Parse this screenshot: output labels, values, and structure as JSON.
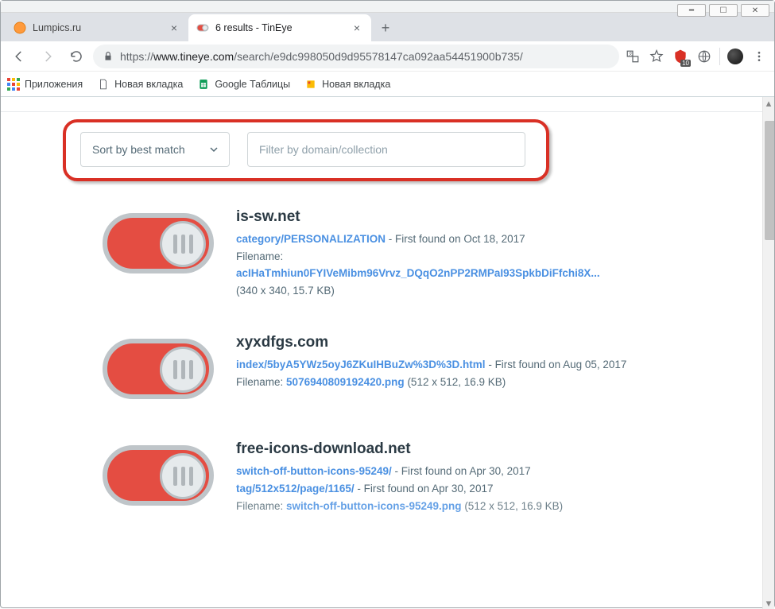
{
  "window": {
    "tabs": [
      {
        "title": "Lumpics.ru",
        "favicon": "orange-circle",
        "active": false
      },
      {
        "title": "6 results - TinEye",
        "favicon": "switch",
        "active": true
      }
    ]
  },
  "address_bar": {
    "scheme": "https://",
    "host": "www.tineye.com",
    "path": "/search/e9dc998050d9d95578147ca092aa54451900b735/",
    "adblock_badge": "10"
  },
  "bookmarks": [
    {
      "label": "Приложения",
      "icon": "apps"
    },
    {
      "label": "Новая вкладка",
      "icon": "page"
    },
    {
      "label": "Google Таблицы",
      "icon": "sheets"
    },
    {
      "label": "Новая вкладка",
      "icon": "page-yellow"
    }
  ],
  "filters": {
    "sort_label": "Sort by best match",
    "filter_placeholder": "Filter by domain/collection"
  },
  "results": [
    {
      "domain": "is-sw.net",
      "path": "category/PERSONALIZATION",
      "first_found": "First found on Oct 18, 2017",
      "filename_label": "Filename:",
      "filename": "acIHaTmhiun0FYIVeMibm96Vrvz_DQqO2nPP2RMPaI93SpkbDiFfchi8X...",
      "dims": "(340 x 340, 15.7 KB)"
    },
    {
      "domain": "xyxdfgs.com",
      "path": "index/5byA5YWz5oyJ6ZKuIHBuZw%3D%3D.html",
      "first_found": "First found on Aug 05, 2017",
      "filename_label": "Filename:",
      "filename": "5076940809192420.png",
      "dims": "(512 x 512, 16.9 KB)"
    },
    {
      "domain": "free-icons-download.net",
      "path": "switch-off-button-icons-95249/",
      "first_found": "First found on Apr 30, 2017",
      "path2": "tag/512x512/page/1165/",
      "first_found2": "First found on Apr 30, 2017",
      "filename_label": "Filename:",
      "filename": "switch-off-button-icons-95249.png",
      "dims": "(512 x 512, 16.9 KB)"
    }
  ]
}
